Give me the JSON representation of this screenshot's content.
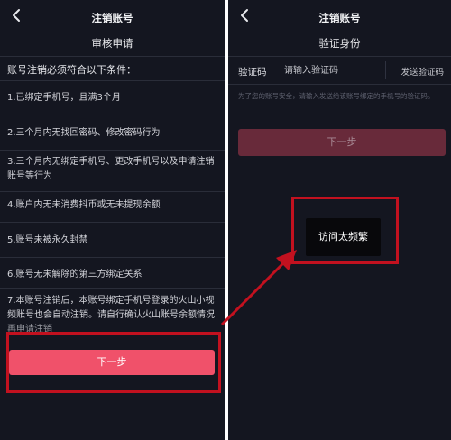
{
  "left": {
    "nav_title": "注销账号",
    "sub_title": "审核申请",
    "conditions_heading": "账号注销必须符合以下条件：",
    "conditions": [
      "1.已绑定手机号，且满3个月",
      "2.三个月内无找回密码、修改密码行为",
      "3.三个月内无绑定手机号、更改手机号以及申请注销账号等行为",
      "4.账户内无未消费抖币或无未提现余额",
      "5.账号未被永久封禁",
      "6.账号无未解除的第三方绑定关系",
      "7.本账号注销后，本账号绑定手机号登录的火山小视频账号也会自动注销。请自行确认火山账号余额情况再申请注销"
    ],
    "next_label": "下一步"
  },
  "right": {
    "nav_title": "注销账号",
    "verify_title": "验证身份",
    "code_label": "验证码",
    "code_placeholder": "请输入验证码",
    "send_code_label": "发送验证码",
    "hint_text": "为了您的账号安全，请输入发送给该账号绑定的手机号的验证码。",
    "next_label": "下一步",
    "toast_text": "访问太频繁"
  },
  "colors": {
    "background": "#141620",
    "primary_button": "#f0516a",
    "disabled_button": "#682a3a",
    "annotation_red": "#c2111f"
  },
  "icons": {
    "back": "chevron-left-icon"
  }
}
